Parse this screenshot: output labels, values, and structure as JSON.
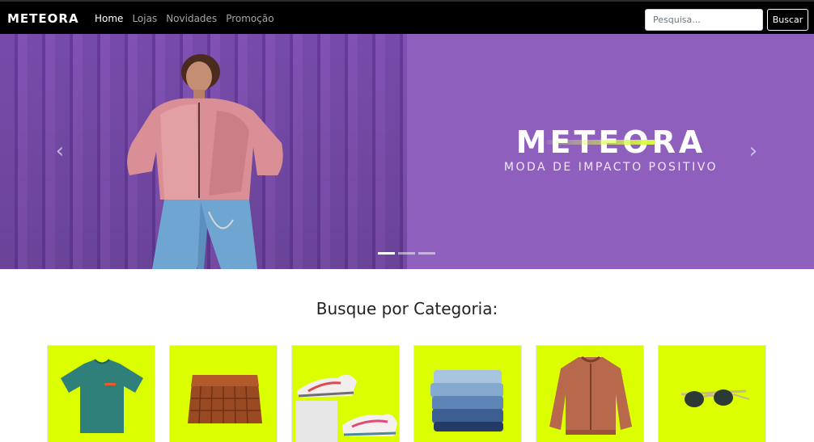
{
  "navbar": {
    "brand": "METEORA",
    "links": [
      {
        "label": "Home",
        "active": true
      },
      {
        "label": "Lojas",
        "active": false
      },
      {
        "label": "Novidades",
        "active": false
      },
      {
        "label": "Promoção",
        "active": false
      }
    ],
    "search_placeholder": "Pesquisa...",
    "search_button": "Buscar"
  },
  "hero": {
    "brand_title": "METEORA",
    "tagline": "MODA DE IMPACTO POSITIVO",
    "slide_count": 3,
    "active_slide": 1,
    "prev_icon": "chevron-left-icon",
    "next_icon": "chevron-right-icon",
    "background_color": "#8e5fbd",
    "accent_color": "#dcff00"
  },
  "categories": {
    "title": "Busque por Categoria:",
    "items": [
      {
        "icon": "tshirt-icon"
      },
      {
        "icon": "bag-icon"
      },
      {
        "icon": "sneakers-icon"
      },
      {
        "icon": "jeans-icon"
      },
      {
        "icon": "jacket-icon"
      },
      {
        "icon": "sunglasses-icon"
      }
    ]
  }
}
